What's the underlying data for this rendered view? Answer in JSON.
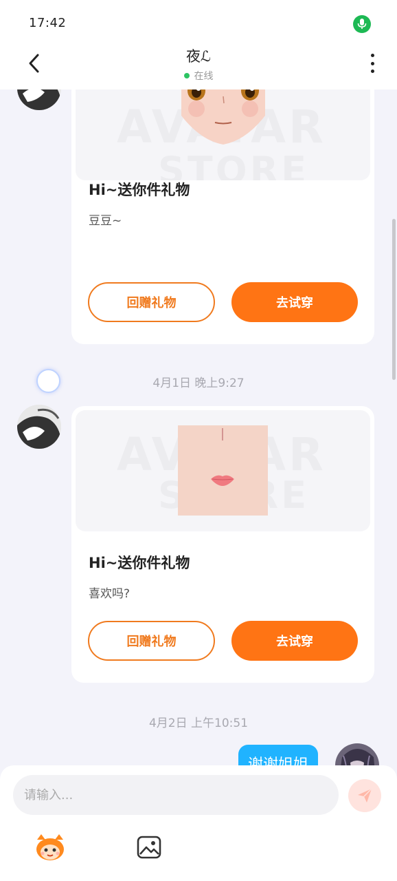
{
  "status_bar": {
    "time": "17:42",
    "icons": [
      "mic-active-icon"
    ]
  },
  "header": {
    "title": "夜ℒ",
    "status": "在线",
    "back_icon": "chevron-left-icon",
    "more_icon": "more-vertical-icon"
  },
  "messages": [
    {
      "type": "gift",
      "sender": "other",
      "title": "Hi~送你件礼物",
      "message": "豆豆~",
      "watermark": [
        "AVATAR",
        "STORE"
      ],
      "buttons": {
        "return_gift": "回赠礼物",
        "try_on": "去试穿"
      }
    },
    {
      "type": "timestamp",
      "text": "4月1日 晚上9:27"
    },
    {
      "type": "gift",
      "sender": "other",
      "title": "Hi~送你件礼物",
      "message": "喜欢吗?",
      "watermark": [
        "AVATAR",
        "STORE"
      ],
      "buttons": {
        "return_gift": "回赠礼物",
        "try_on": "去试穿"
      }
    },
    {
      "type": "timestamp",
      "text": "4月2日 上午10:51"
    },
    {
      "type": "text",
      "sender": "self",
      "text": "谢谢姐姐"
    }
  ],
  "input": {
    "placeholder": "请输入...",
    "value": "",
    "send_icon": "send-icon",
    "emoji_icon": "mascot-emoji-icon",
    "image_icon": "image-icon"
  },
  "colors": {
    "accent": "#FF7414",
    "online": "#2DC463",
    "bubble_self": "#20B3FF",
    "background": "#F3F3FA"
  }
}
